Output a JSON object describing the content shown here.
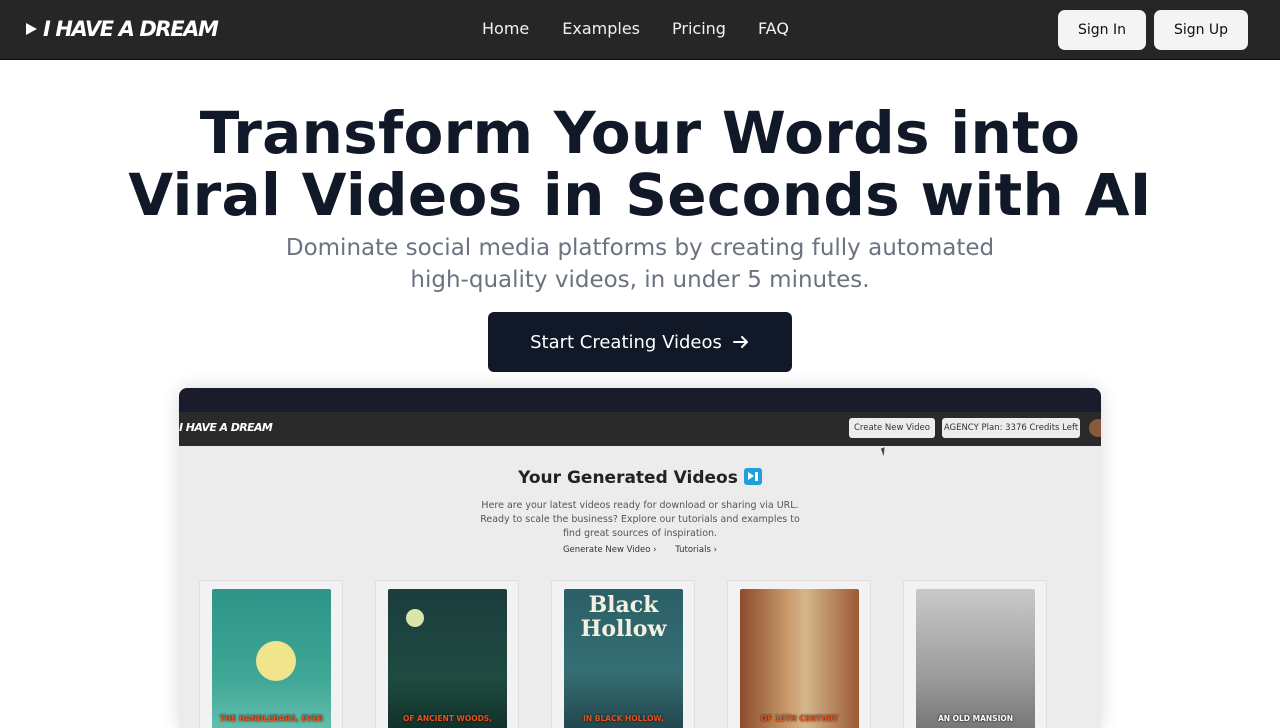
{
  "brand": {
    "name": "I HAVE A DREAM"
  },
  "nav": {
    "items": [
      {
        "label": "Home"
      },
      {
        "label": "Examples"
      },
      {
        "label": "Pricing"
      },
      {
        "label": "FAQ"
      }
    ]
  },
  "auth": {
    "sign_in": "Sign In",
    "sign_up": "Sign Up"
  },
  "hero": {
    "title_line1": "Transform Your Words into",
    "title_line2": "Viral Videos in Seconds with AI",
    "subtitle_line1": "Dominate social media platforms by creating fully automated",
    "subtitle_line2": "high-quality videos, in under 5 minutes.",
    "cta_label": "Start Creating Videos"
  },
  "preview": {
    "logo": "I HAVE A DREAM",
    "create_button": "Create New Video",
    "plan_badge": "AGENCY Plan: 3376 Credits Left",
    "title": "Your Generated Videos",
    "description": "Here are your latest videos ready for download or sharing via URL. Ready to scale the business? Explore our tutorials and examples to find great sources of inspiration.",
    "links": [
      {
        "label": "Generate New Video ›"
      },
      {
        "label": "Tutorials ›"
      }
    ],
    "videos": [
      {
        "caption": "THE HANDLEBARS, EVER"
      },
      {
        "caption": "OF ANCIENT WOODS,"
      },
      {
        "caption": "IN BLACK HOLLOW,",
        "title": "Black Hollow"
      },
      {
        "caption": "OF 15TH CENTURY"
      },
      {
        "caption": "AN OLD MANSION"
      }
    ]
  },
  "colors": {
    "topbar": "#262626",
    "cta": "#111827",
    "title": "#111827",
    "subtitle": "#6b7280",
    "accent_icon": "#1fa0d8"
  },
  "icons": {
    "logo": "play-icon",
    "cta": "arrow-right-icon",
    "title": "play-pause-icon"
  }
}
